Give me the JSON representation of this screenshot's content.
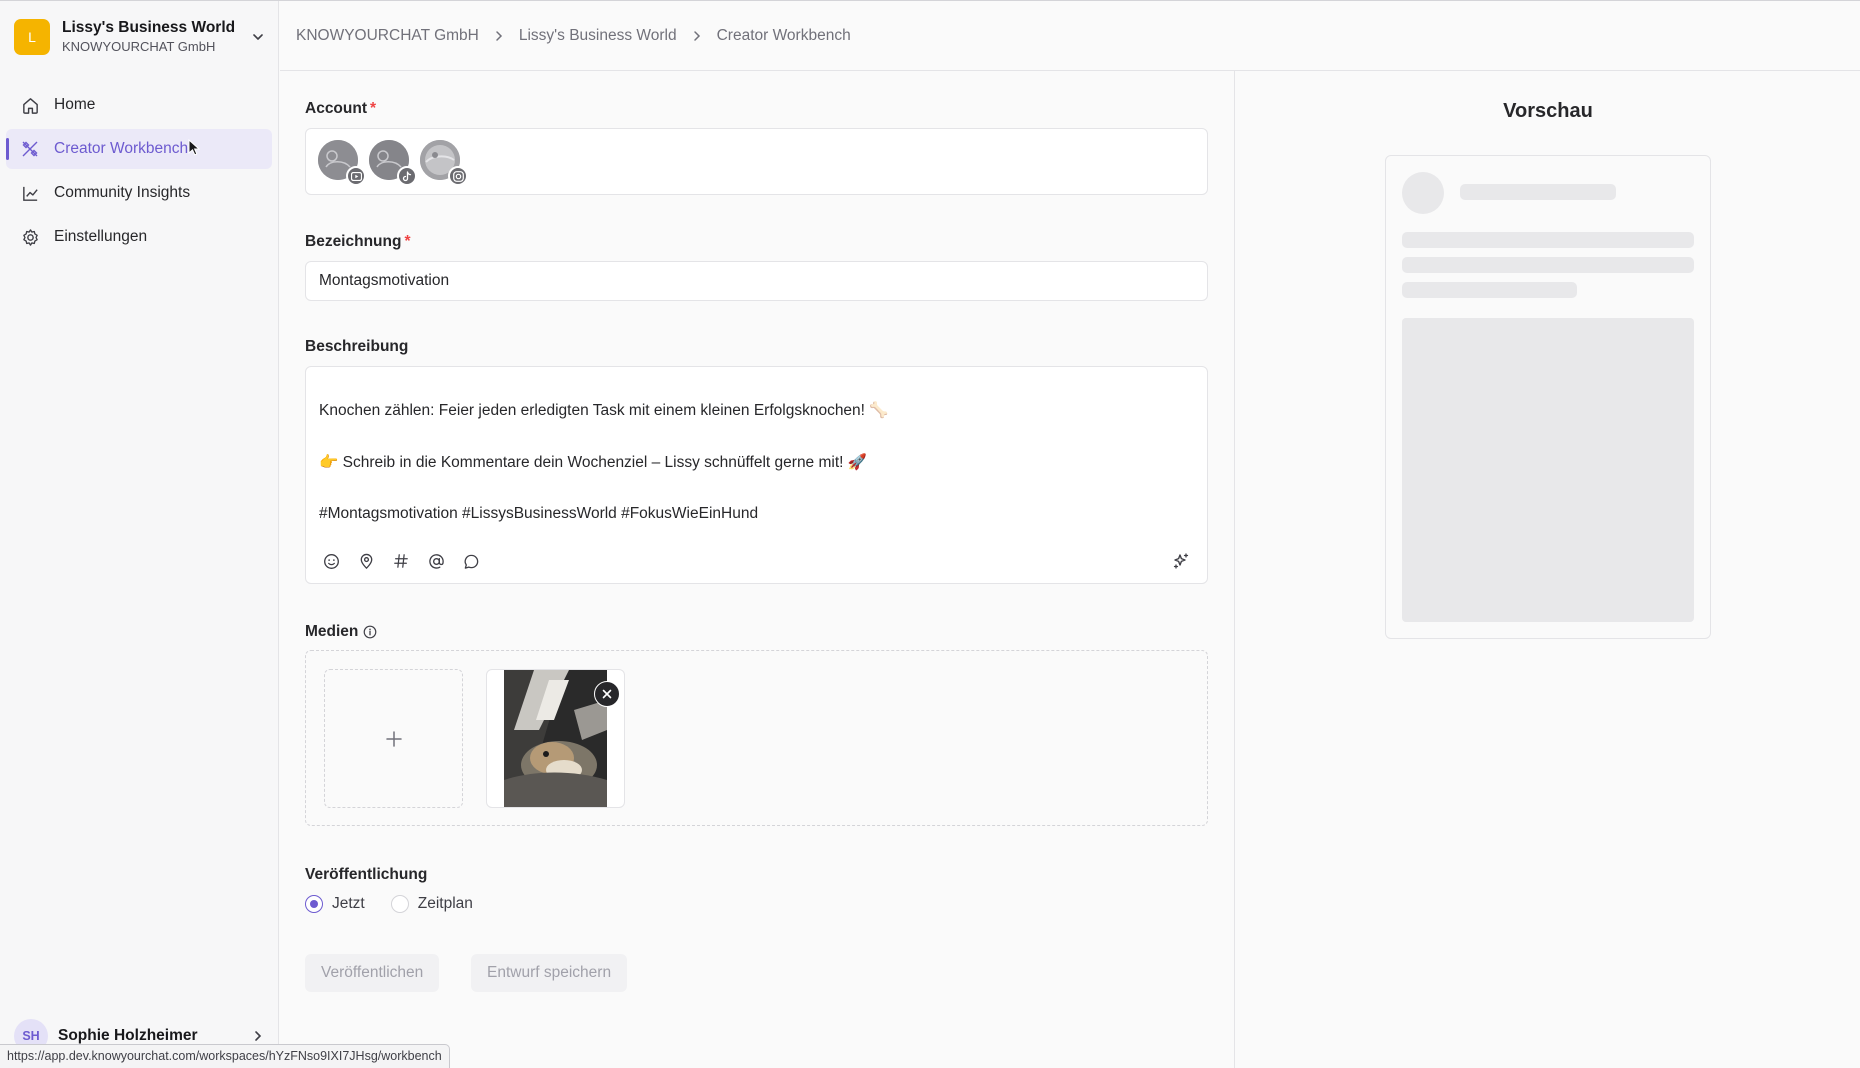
{
  "workspace": {
    "logo_letter": "L",
    "name": "Lissy's Business World",
    "company": "KNOWYOURCHAT GmbH"
  },
  "nav": {
    "items": [
      {
        "label": "Home",
        "icon": "home-icon"
      },
      {
        "label": "Creator Workbench",
        "icon": "sparkle-icon",
        "active": true
      },
      {
        "label": "Community Insights",
        "icon": "chart-line-icon"
      },
      {
        "label": "Einstellungen",
        "icon": "gear-icon"
      }
    ]
  },
  "user": {
    "initials": "SH",
    "name": "Sophie Holzheimer"
  },
  "status_url": "https://app.dev.knowyourchat.com/workspaces/hYzFNso9IXI7JHsg/workbench",
  "breadcrumb": [
    "KNOWYOURCHAT GmbH",
    "Lissy's Business World",
    "Creator Workbench"
  ],
  "form": {
    "account_label": "Account",
    "accounts": [
      {
        "platform": "youtube",
        "badge_icon": "youtube-icon"
      },
      {
        "platform": "tiktok",
        "badge_icon": "tiktok-icon"
      },
      {
        "platform": "instagram",
        "badge_icon": "instagram-icon"
      }
    ],
    "title_label": "Bezeichnung",
    "title_value": "Montagsmotivation",
    "description_label": "Beschreibung",
    "description_lines": [
      "Knochen zählen: Feier jeden erledigten Task mit einem kleinen Erfolgsknochen! 🦴",
      "👉 Schreib in die Kommentare dein Wochenziel – Lissy schnüffelt gerne mit! 🚀",
      "#Montagsmotivation #LissysBusinessWorld #FokusWieEinHund"
    ],
    "toolbar_icons": [
      "emoji-icon",
      "location-pin-icon",
      "hashtag-icon",
      "mention-icon",
      "comment-icon",
      "ai-sparkle-icon"
    ],
    "media_label": "Medien",
    "publish_label": "Veröffentlichung",
    "publish_options": [
      {
        "label": "Jetzt",
        "selected": true
      },
      {
        "label": "Zeitplan",
        "selected": false
      }
    ],
    "publish_button": "Veröffentlichen",
    "draft_button": "Entwurf speichern"
  },
  "preview": {
    "title": "Vorschau"
  },
  "colors": {
    "accent": "#6d5bd0",
    "workspace_logo": "#f5b400",
    "required": "#ef4444"
  }
}
